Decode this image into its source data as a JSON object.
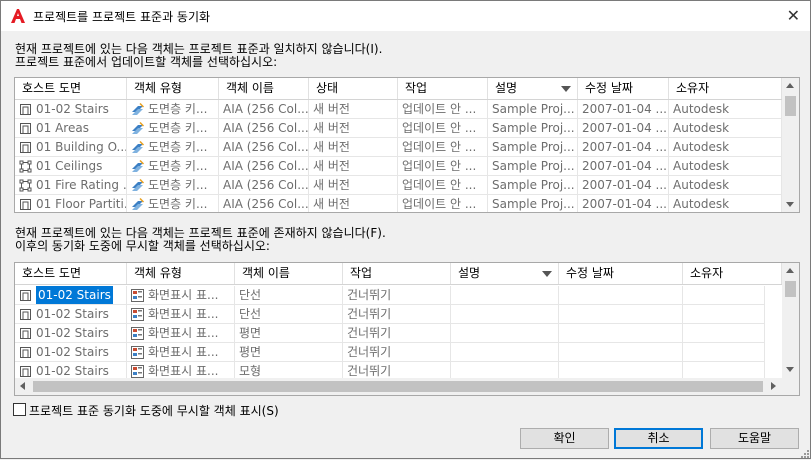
{
  "window": {
    "title": "프로젝트를 프로젝트 표준과 동기화",
    "close_icon": "close-icon"
  },
  "top": {
    "message_line1": "현재 프로젝트에 있는 다음 객체는 프로젝트 표준과 일치하지 않습니다(I).",
    "message_line2": "프로젝트 표준에서 업데이트할 객체를 선택하십시오:",
    "columns": [
      "호스트 도면",
      "객체 유형",
      "객체 이름",
      "상태",
      "작업",
      "설명",
      "수정 날짜",
      "소유자"
    ],
    "sorted_column": "설명",
    "rows": [
      {
        "host": "01-02 Stairs",
        "type": "도면층 키...",
        "name": "AIA (256 Col...",
        "status": "새 버전",
        "action": "업데이트 안 ...",
        "desc": "Sample Proj...",
        "date": "2007-01-04 ...",
        "owner": "Autodesk",
        "icon": "stairs-icon"
      },
      {
        "host": "01 Areas",
        "type": "도면층 키...",
        "name": "AIA (256 Col...",
        "status": "새 버전",
        "action": "업데이트 안 ...",
        "desc": "Sample Proj...",
        "date": "2007-01-04 ...",
        "owner": "Autodesk",
        "icon": "drawing-icon"
      },
      {
        "host": "01 Building O...",
        "type": "도면층 키...",
        "name": "AIA (256 Col...",
        "status": "새 버전",
        "action": "업데이트 안 ...",
        "desc": "Sample Proj...",
        "date": "2007-01-04 ...",
        "owner": "Autodesk",
        "icon": "drawing-icon"
      },
      {
        "host": "01 Ceilings",
        "type": "도면층 키...",
        "name": "AIA (256 Col...",
        "status": "새 버전",
        "action": "업데이트 안 ...",
        "desc": "Sample Proj...",
        "date": "2007-01-04 ...",
        "owner": "Autodesk",
        "icon": "construct-icon"
      },
      {
        "host": "01 Fire Rating ...",
        "type": "도면층 키...",
        "name": "AIA (256 Col...",
        "status": "새 버전",
        "action": "업데이트 안 ...",
        "desc": "Sample Proj...",
        "date": "2007-01-04 ...",
        "owner": "Autodesk",
        "icon": "construct-icon"
      },
      {
        "host": "01 Floor Partiti...",
        "type": "도면층 키...",
        "name": "AIA (256 Col...",
        "status": "새 버전",
        "action": "업데이트 안 ...",
        "desc": "Sample Proj...",
        "date": "2007-01-04 ...",
        "owner": "Autodesk",
        "icon": "drawing-icon"
      }
    ]
  },
  "bottom": {
    "message_line1": "현재 프로젝트에 있는 다음 객체는 프로젝트 표준에 존재하지 않습니다(F).",
    "message_line2": "이후의 동기화 도중에 무시할 객체를 선택하십시오:",
    "columns": [
      "호스트 도면",
      "객체 유형",
      "객체 이름",
      "작업",
      "설명",
      "수정 날짜",
      "소유자"
    ],
    "sorted_column": "설명",
    "rows": [
      {
        "host": "01-02 Stairs",
        "type": "화면표시 표...",
        "name": "단선",
        "action": "건너뛰기",
        "selected": true
      },
      {
        "host": "01-02 Stairs",
        "type": "화면표시 표...",
        "name": "단선",
        "action": "건너뛰기",
        "selected": false
      },
      {
        "host": "01-02 Stairs",
        "type": "화면표시 표...",
        "name": "평면",
        "action": "건너뛰기",
        "selected": false
      },
      {
        "host": "01-02 Stairs",
        "type": "화면표시 표...",
        "name": "평면",
        "action": "건너뛰기",
        "selected": false
      },
      {
        "host": "01-02 Stairs",
        "type": "화면표시 표...",
        "name": "모형",
        "action": "건너뛰기",
        "selected": false
      }
    ]
  },
  "checkbox": {
    "label": "프로젝트 표준 동기화 도중에 무시할 객체 표시(S)",
    "checked": false
  },
  "buttons": {
    "ok": "확인",
    "cancel": "취소",
    "help": "도움말"
  },
  "colors": {
    "selection": "#0078d7",
    "layerkey_icon": "#3b7fc4",
    "display_icon": "#c84b31"
  }
}
